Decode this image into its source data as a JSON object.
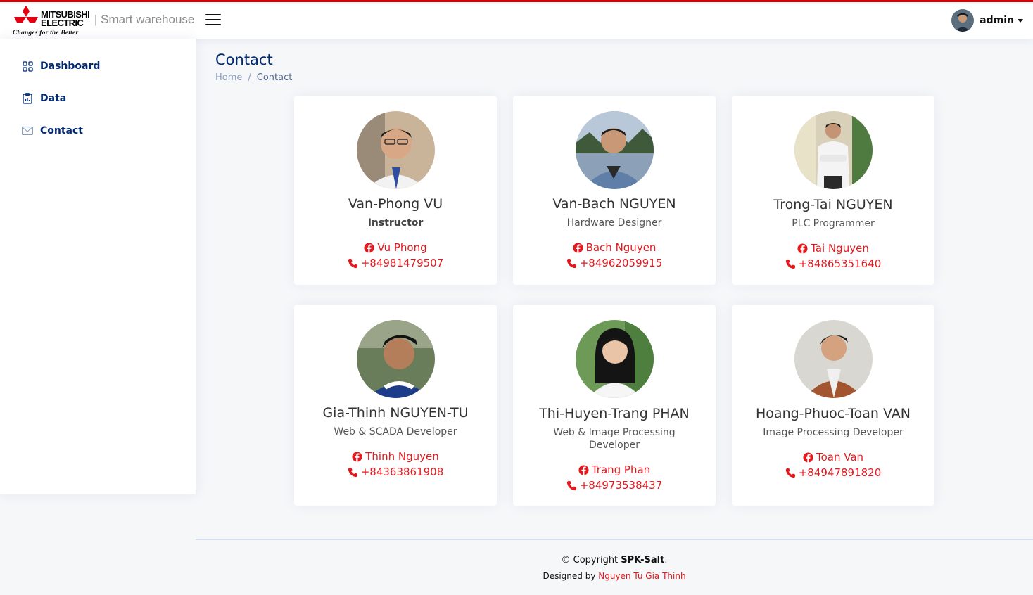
{
  "brand": {
    "line1": "MITSUBISHI",
    "line2": "ELECTRIC",
    "tagline": "Changes for the Better",
    "app_title": "| Smart warehouse",
    "accent_color": "#e00000"
  },
  "user": {
    "name": "admin"
  },
  "sidebar": {
    "items": [
      {
        "label": "Dashboard",
        "icon": "grid-icon"
      },
      {
        "label": "Data",
        "icon": "clipboard-chart-icon"
      },
      {
        "label": "Contact",
        "icon": "envelope-icon"
      }
    ]
  },
  "page": {
    "title": "Contact",
    "breadcrumb": {
      "home": "Home",
      "separator": "/",
      "current": "Contact"
    }
  },
  "contacts": [
    {
      "name": "Van-Phong VU",
      "role": "Instructor",
      "facebook": "Vu Phong",
      "phone": "+84981479507"
    },
    {
      "name": "Van-Bach NGUYEN",
      "role": "Hardware Designer",
      "facebook": "Bach Nguyen",
      "phone": "+84962059915"
    },
    {
      "name": "Trong-Tai NGUYEN",
      "role": "PLC Programmer",
      "facebook": "Tai Nguyen",
      "phone": "+84865351640"
    },
    {
      "name": "Gia-Thinh NGUYEN-TU",
      "role": "Web & SCADA Developer",
      "facebook": "Thinh Nguyen",
      "phone": "+84363861908"
    },
    {
      "name": "Thi-Huyen-Trang PHAN",
      "role": "Web & Image Processing Developer",
      "facebook": "Trang Phan",
      "phone": "+84973538437"
    },
    {
      "name": "Hoang-Phuoc-Toan VAN",
      "role": "Image Processing Developer",
      "facebook": "Toan Van",
      "phone": "+84947891820"
    }
  ],
  "footer": {
    "copyright_prefix": "© Copyright ",
    "copyright_owner": "SPK-Salt",
    "copyright_suffix": ".",
    "designed_by": "Designed by ",
    "designer": "Nguyen Tu Gia Thinh"
  }
}
